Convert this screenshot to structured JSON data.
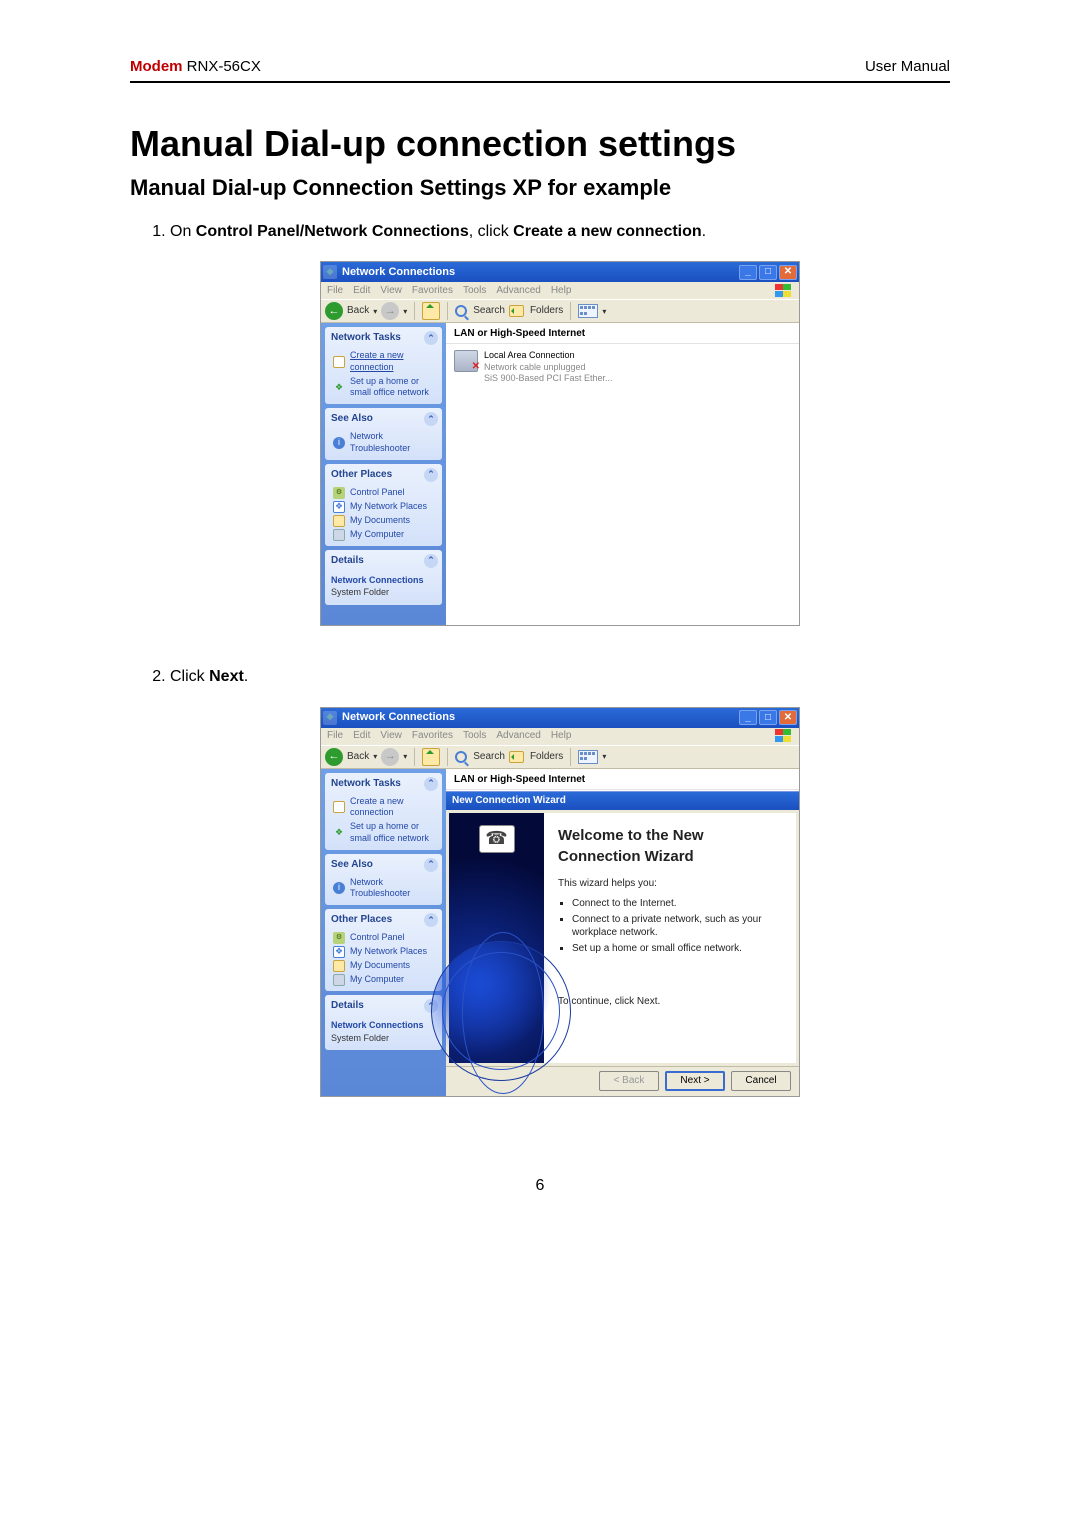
{
  "header": {
    "brand": "Modem",
    "model": "RNX-56CX",
    "right": "User Manual"
  },
  "h1": "Manual Dial-up connection settings",
  "h2": "Manual Dial-up Connection Settings XP for example",
  "step1": {
    "pre": "On ",
    "b1": "Control Panel/Network Connections",
    "mid": ", click ",
    "b2": "Create a new connection",
    "post": "."
  },
  "step2": {
    "pre": "Click ",
    "b1": "Next",
    "post": "."
  },
  "win": {
    "title": "Network Connections",
    "menus": [
      "File",
      "Edit",
      "View",
      "Favorites",
      "Tools",
      "Advanced",
      "Help"
    ],
    "toolbar": {
      "back": "Back",
      "search": "Search",
      "folders": "Folders"
    },
    "side": {
      "tasks_hd": "Network Tasks",
      "tasks": [
        "Create a new connection",
        "Set up a home or small office network"
      ],
      "see_hd": "See Also",
      "see": [
        "Network Troubleshooter"
      ],
      "other_hd": "Other Places",
      "other": [
        "Control Panel",
        "My Network Places",
        "My Documents",
        "My Computer"
      ],
      "details_hd": "Details",
      "details_bold": "Network Connections",
      "details_sub": "System Folder"
    },
    "content": {
      "cat": "LAN or High-Speed Internet",
      "conn_name": "Local Area Connection",
      "conn_l2": "Network cable unplugged",
      "conn_l3": "SiS 900-Based PCI Fast Ether..."
    }
  },
  "wizard": {
    "title": "New Connection Wizard",
    "heading": "Welcome to the New Connection Wizard",
    "intro": "This wizard helps you:",
    "bullets": [
      "Connect to the Internet.",
      "Connect to a private network, such as your workplace network.",
      "Set up a home or small office network."
    ],
    "cont": "To continue, click Next.",
    "back": "< Back",
    "next": "Next >",
    "cancel": "Cancel"
  },
  "page_number": "6"
}
